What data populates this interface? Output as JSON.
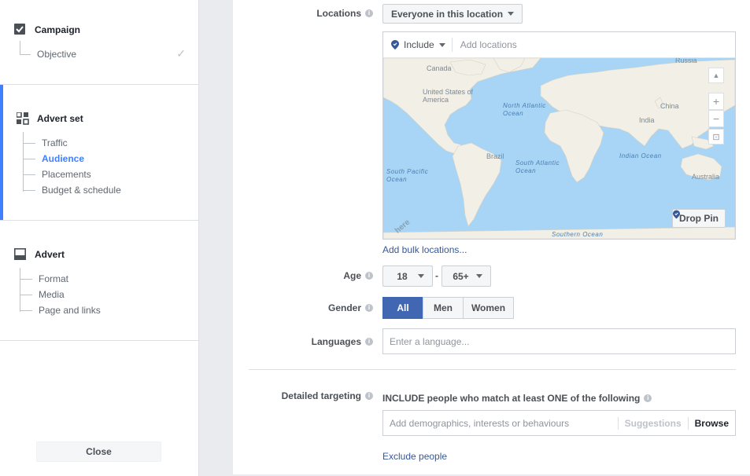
{
  "sidebar": {
    "campaign": {
      "title": "Campaign",
      "items": [
        {
          "label": "Objective"
        }
      ]
    },
    "advert_set": {
      "title": "Advert set",
      "items": [
        {
          "label": "Traffic"
        },
        {
          "label": "Audience"
        },
        {
          "label": "Placements"
        },
        {
          "label": "Budget & schedule"
        }
      ]
    },
    "advert": {
      "title": "Advert",
      "items": [
        {
          "label": "Format"
        },
        {
          "label": "Media"
        },
        {
          "label": "Page and links"
        }
      ]
    },
    "close_label": "Close"
  },
  "locations": {
    "label": "Locations",
    "mode": "Everyone in this location",
    "include_label": "Include",
    "placeholder": "Add locations",
    "bulk_link": "Add bulk locations...",
    "drop_pin": "Drop Pin",
    "map": {
      "countries": [
        "Russia",
        "Canada",
        "United States of America",
        "China",
        "India",
        "Brazil",
        "Australia"
      ],
      "oceans": [
        "North Atlantic Ocean",
        "South Atlantic Ocean",
        "Indian Ocean",
        "South Pacific Ocean",
        "Southern Ocean"
      ],
      "watermark": "here"
    }
  },
  "age": {
    "label": "Age",
    "min": "18",
    "max": "65+",
    "separator": "-"
  },
  "gender": {
    "label": "Gender",
    "options": [
      "All",
      "Men",
      "Women"
    ],
    "selected": "All"
  },
  "languages": {
    "label": "Languages",
    "placeholder": "Enter a language..."
  },
  "detailed_targeting": {
    "label": "Detailed targeting",
    "include_text": "INCLUDE people who match at least ONE of the following",
    "placeholder": "Add demographics, interests or behaviours",
    "suggestions": "Suggestions",
    "browse": "Browse",
    "exclude_link": "Exclude people"
  },
  "colors": {
    "accent": "#4080ff",
    "primary": "#4267b2",
    "link": "#365899",
    "ocean": "#a8d4f5",
    "land": "#f2efe6"
  }
}
